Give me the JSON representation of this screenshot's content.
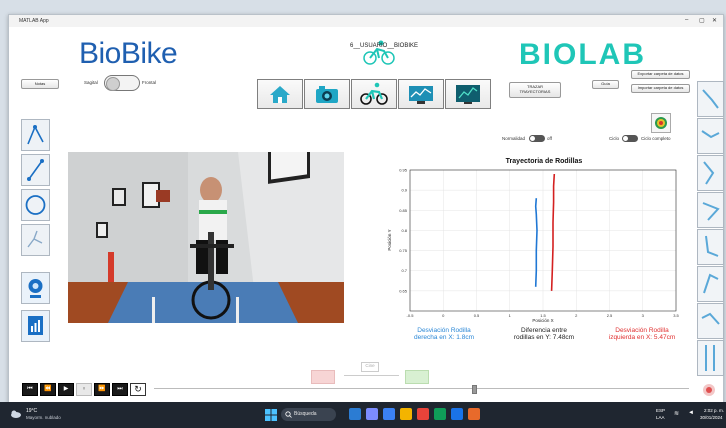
{
  "window": {
    "title": "MATLAB App",
    "min": "–",
    "max": "▢",
    "close": "✕"
  },
  "header": {
    "logo_left": "BioBike",
    "logo_right": "BIOLAB",
    "user": "6__USUARIO__BIOBIKE",
    "notes_label": "Notas",
    "sagital_label": "Sagital",
    "frontal_label": "Frontal",
    "trazar_label": "TRAZAR\nTRAYECTORIAS",
    "guia_label": "Guía",
    "export_label": "Exportar carpeta de datos",
    "import_label": "Importar carpeta de datos"
  },
  "toolbar": {
    "tools": [
      "home-icon",
      "camera-icon",
      "cyclist-icon",
      "monitor-chart-icon",
      "screen-chart-icon"
    ]
  },
  "controls": {
    "normalidad_label": "Normalidad",
    "normalidad_state": "off",
    "ciclo_label": "Ciclo",
    "ciclo_completo_label": "Ciclo completo"
  },
  "chart_data": {
    "type": "line",
    "title": "Trayectoria de Rodillas",
    "xlabel": "Posición X",
    "ylabel": "Posición Y",
    "xlim": [
      -0.5,
      3.5
    ],
    "ylim": [
      0.6,
      0.95
    ],
    "xticks": [
      "-0.5",
      "0",
      "0.5",
      "1",
      "1.5",
      "2",
      "2.5",
      "3",
      "3.5"
    ],
    "yticks": [
      "0.95",
      "0.9",
      "0.85",
      "0.8",
      "0.75",
      "0.7",
      "0.65"
    ],
    "grid": true,
    "series": [
      {
        "x": [
          1.39,
          1.4,
          1.4,
          1.41,
          1.4,
          1.39,
          1.4
        ],
        "y": [
          0.66,
          0.7,
          0.75,
          0.8,
          0.84,
          0.86,
          0.88
        ],
        "color": "#1f77d4"
      },
      {
        "x": [
          1.63,
          1.64,
          1.65,
          1.65,
          1.66,
          1.66,
          1.67
        ],
        "y": [
          0.65,
          0.7,
          0.76,
          0.82,
          0.87,
          0.91,
          0.94
        ],
        "color": "#d42020"
      }
    ]
  },
  "stats": {
    "right_label": "Desviación Rodilla\nderecha en X: 1.8cm",
    "diff_label": "Diferencia entre\nrodillas en Y: 7.48cm",
    "left_label": "Desviación Rodilla\nizquierda en X: 5.47cm",
    "right_color": "#2a87d6",
    "left_color": "#e03030"
  },
  "playback": {
    "buttons": [
      "⏮",
      "⏪",
      "▶",
      "⏸",
      "⏩",
      "⏭",
      "↻"
    ],
    "slider_value": 0.58,
    "ghost_label": "Cine"
  },
  "taskbar": {
    "weather_temp": "19°C",
    "weather_desc": "Mayorm. nublado",
    "search_placeholder": "Búsqueda",
    "lang": "ESP",
    "lang2": "LAA",
    "time": "2:02 p. m.",
    "date": "30/01/2024"
  },
  "colors": {
    "brand_blue": "#1f5fb0",
    "brand_teal": "#1fc6b7",
    "panel_blue": "#1a6fc4"
  }
}
